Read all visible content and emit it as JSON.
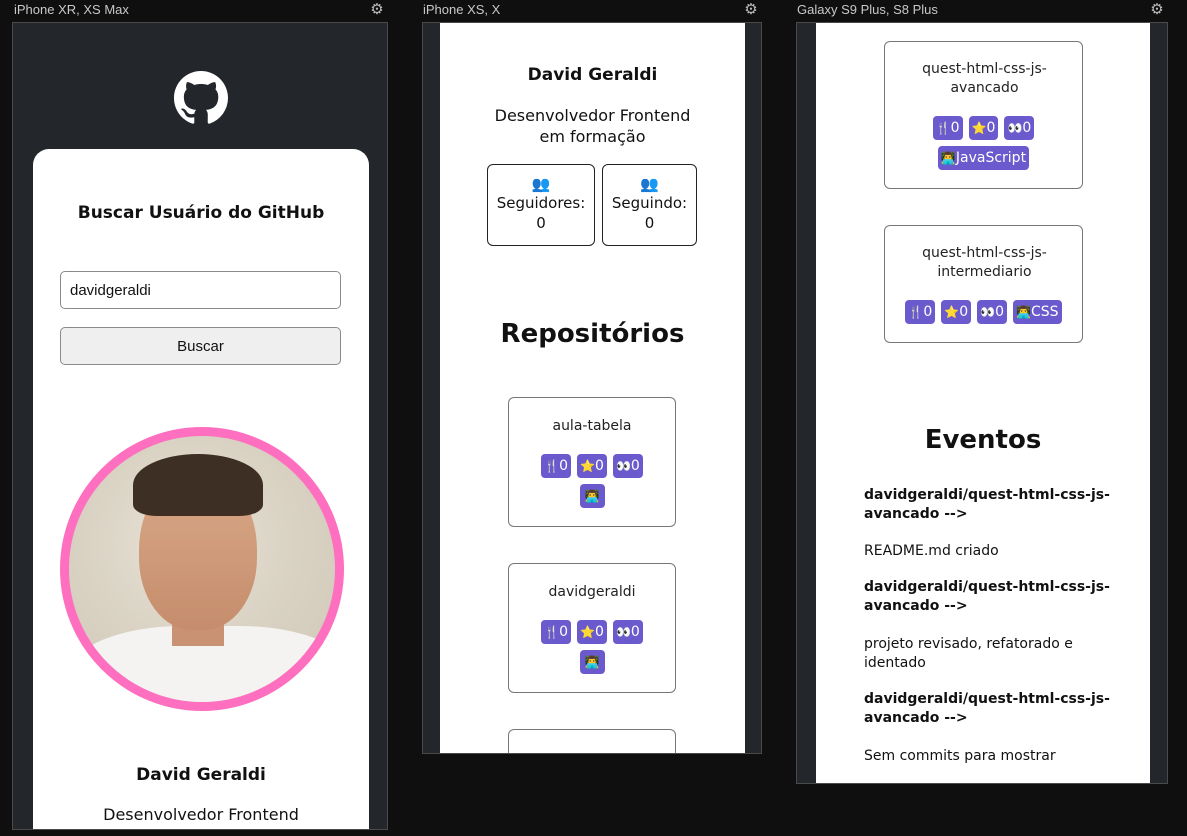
{
  "devices": [
    {
      "label": "iPhone XR, XS Max"
    },
    {
      "label": "iPhone XS, X"
    },
    {
      "label": "Galaxy S9 Plus, S8 Plus"
    }
  ],
  "search": {
    "title": "Buscar Usuário do GitHub",
    "value": "davidgeraldi",
    "button": "Buscar"
  },
  "profile": {
    "name": "David Geraldi",
    "bio": "Desenvolvedor Frontend em formação",
    "bio_short": "Desenvolvedor Frontend",
    "followers_label": "Seguidores:",
    "followers": "0",
    "following_label": "Seguindo:",
    "following": "0",
    "people_icon": "👥",
    "avatar_ring_color": "#ff6fbf"
  },
  "repos_title": "Repositórios",
  "repos": [
    {
      "name": "aula-tabela",
      "forks": "0",
      "stars": "0",
      "watchers": "0",
      "language": ""
    },
    {
      "name": "davidgeraldi",
      "forks": "0",
      "stars": "0",
      "watchers": "0",
      "language": ""
    },
    {
      "name": "quest-html-css-js-avancado",
      "forks": "0",
      "stars": "0",
      "watchers": "0",
      "language": "JavaScript"
    },
    {
      "name": "quest-html-css-js-intermediario",
      "forks": "0",
      "stars": "0",
      "watchers": "0",
      "language": "CSS"
    }
  ],
  "icons": {
    "fork": "🍴",
    "star": "⭐",
    "watch": "👀",
    "lang": "👨‍💻",
    "gear": "⚙"
  },
  "badge_color": "#6a5acd",
  "events_title": "Eventos",
  "events": [
    {
      "repo": "davidgeraldi/quest-html-css-js-avancado -->",
      "message": "README.md criado"
    },
    {
      "repo": "davidgeraldi/quest-html-css-js-avancado -->",
      "message": "projeto revisado, refatorado e identado"
    },
    {
      "repo": "davidgeraldi/quest-html-css-js-avancado -->",
      "message": "Sem commits para mostrar"
    }
  ]
}
